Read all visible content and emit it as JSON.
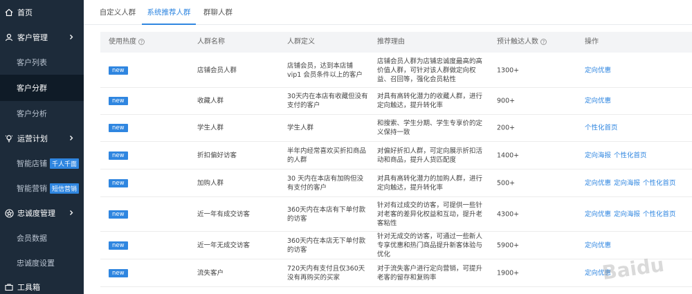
{
  "sidebar": {
    "items": [
      {
        "label": "首页",
        "icon": "home-icon",
        "type": "top"
      },
      {
        "label": "客户管理",
        "icon": "user-icon",
        "type": "top",
        "chevron": true
      },
      {
        "label": "客户列表",
        "type": "sub"
      },
      {
        "label": "客户分群",
        "type": "sub",
        "active": true
      },
      {
        "label": "客户分析",
        "type": "sub"
      },
      {
        "label": "运营计划",
        "icon": "bulb-icon",
        "type": "top",
        "chevron": true
      },
      {
        "label": "智能店铺",
        "type": "sub",
        "tag": "千人千面"
      },
      {
        "label": "智能营销",
        "type": "sub",
        "tag": "短信营销"
      },
      {
        "label": "忠诚度管理",
        "icon": "star-icon",
        "type": "top",
        "chevron": true
      },
      {
        "label": "会员数据",
        "type": "sub"
      },
      {
        "label": "忠诚度设置",
        "type": "sub"
      },
      {
        "label": "工具箱",
        "icon": "toolbox-icon",
        "type": "top"
      }
    ]
  },
  "tabs": [
    {
      "label": "自定义人群"
    },
    {
      "label": "系统推荐人群",
      "active": true
    },
    {
      "label": "群聊人群"
    }
  ],
  "table": {
    "headers": {
      "heat": "使用热度",
      "name": "人群名称",
      "definition": "人群定义",
      "reason": "推荐理由",
      "count": "预计触达人数",
      "ops": "操作"
    },
    "badge_label": "new",
    "rows": [
      {
        "name": "店铺会员人群",
        "definition": "店铺会员，达到本店铺 vip1 会员条件以上的客户",
        "reason": "店铺会员人群为店铺忠诚度最高的高价值人群，可针对该人群做定向权益、召回等，强化会员粘性",
        "count": "1300+",
        "ops": [
          "定向优惠"
        ]
      },
      {
        "name": "收藏人群",
        "definition": "30天内在本店有收藏但没有支付的客户",
        "reason": "对具有高转化潜力的收藏人群，进行定向触达，提升转化率",
        "count": "900+",
        "ops": [
          "定向优惠"
        ]
      },
      {
        "name": "学生人群",
        "definition": "学生人群",
        "reason": "和搜索、学生分期、学生专享价的定义保持一致",
        "count": "200+",
        "ops": [
          "个性化首页"
        ]
      },
      {
        "name": "折扣偏好访客",
        "definition": "半年内经常喜欢买折扣商品的人群",
        "reason": "对偏好折扣人群，可定向展示折扣活动和商品，提升人货匹配度",
        "count": "1400+",
        "ops": [
          "定向海报",
          "个性化首页"
        ]
      },
      {
        "name": "加购人群",
        "definition": "30 天内在本店有加购但没有支付的客户",
        "reason": "对具有高转化潜力的加购人群，进行定向触达，提升转化率",
        "count": "500+",
        "ops": [
          "定向优惠",
          "定向海报",
          "个性化首页"
        ]
      },
      {
        "name": "近一年有成交访客",
        "definition": "360天内在本店有下单付款的访客",
        "reason": "针对有过成交的访客，可提供一些针对老客的差异化权益和互动，提升老客粘性",
        "count": "4300+",
        "ops": [
          "定向优惠",
          "定向海报",
          "个性化首页"
        ]
      },
      {
        "name": "近一年无成交访客",
        "definition": "360天内在本店无下单付款的访客",
        "reason": "针对无成交的访客，可通过一些新人专享优惠和热门商品提升新客体验与优化",
        "count": "5900+",
        "ops": [
          "定向优惠"
        ]
      },
      {
        "name": "流失客户",
        "definition": "720天内有支付且仅360天没有再购买的买家",
        "reason": "对于流失客户进行定向营销，可提升老客的留存和复购率",
        "count": "1900+",
        "ops": [
          "定向优惠"
        ]
      }
    ]
  },
  "watermark": "Baidu"
}
